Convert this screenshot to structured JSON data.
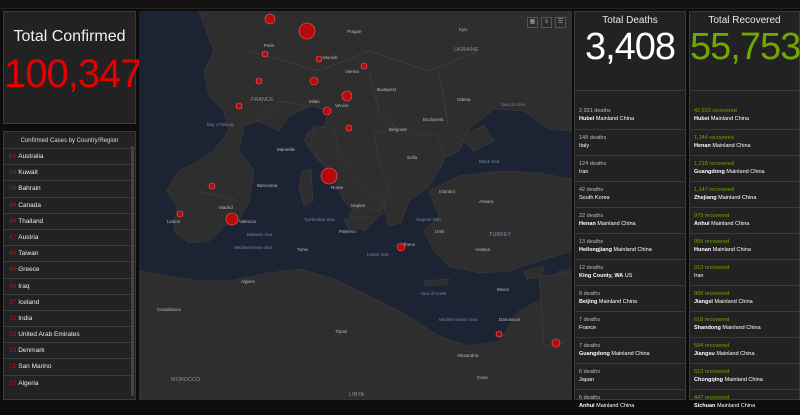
{
  "confirmed": {
    "title": "Total Confirmed",
    "value": "100,347"
  },
  "country_list": {
    "header": "Confirmed Cases by Country/Region",
    "items": [
      {
        "num": "61",
        "name": "Australia"
      },
      {
        "num": "58",
        "name": "Kuwait"
      },
      {
        "num": "55",
        "name": "Bahrain"
      },
      {
        "num": "48",
        "name": "Canada"
      },
      {
        "num": "48",
        "name": "Thailand"
      },
      {
        "num": "47",
        "name": "Austria"
      },
      {
        "num": "45",
        "name": "Taiwan"
      },
      {
        "num": "45",
        "name": "Greece"
      },
      {
        "num": "40",
        "name": "Iraq"
      },
      {
        "num": "37",
        "name": "Iceland"
      },
      {
        "num": "31",
        "name": "India"
      },
      {
        "num": "29",
        "name": "United Arab Emirates"
      },
      {
        "num": "23",
        "name": "Denmark"
      },
      {
        "num": "21",
        "name": "San Marino"
      },
      {
        "num": "17",
        "name": "Algeria"
      }
    ]
  },
  "deaths": {
    "title": "Total Deaths",
    "value": "3,408",
    "items": [
      {
        "count": "2,931 deaths",
        "region": "Hubei",
        "country": "Mainland China"
      },
      {
        "count": "148 deaths",
        "region": "",
        "country": "Italy"
      },
      {
        "count": "124 deaths",
        "region": "",
        "country": "Iran"
      },
      {
        "count": "42 deaths",
        "region": "",
        "country": "South Korea"
      },
      {
        "count": "22 deaths",
        "region": "Henan",
        "country": "Mainland China"
      },
      {
        "count": "13 deaths",
        "region": "Heilongjiang",
        "country": "Mainland China"
      },
      {
        "count": "12 deaths",
        "region": "King County, WA",
        "country": "US"
      },
      {
        "count": "8 deaths",
        "region": "Beijing",
        "country": "Mainland China"
      },
      {
        "count": "7 deaths",
        "region": "",
        "country": "France"
      },
      {
        "count": "7 deaths",
        "region": "Guangdong",
        "country": "Mainland China"
      },
      {
        "count": "6 deaths",
        "region": "",
        "country": "Japan"
      },
      {
        "count": "6 deaths",
        "region": "Anhui",
        "country": "Mainland China"
      }
    ]
  },
  "recovered": {
    "title": "Total Recovered",
    "value": "55,753",
    "items": [
      {
        "count": "42,633 recovered",
        "region": "Hubei",
        "country": "Mainland China"
      },
      {
        "count": "1,244 recovered",
        "region": "Henan",
        "country": "Mainland China"
      },
      {
        "count": "1,218 recovered",
        "region": "Guangdong",
        "country": "Mainland China"
      },
      {
        "count": "1,147 recovered",
        "region": "Zhejiang",
        "country": "Mainland China"
      },
      {
        "count": "979 recovered",
        "region": "Anhui",
        "country": "Mainland China"
      },
      {
        "count": "955 recovered",
        "region": "Hunan",
        "country": "Mainland China"
      },
      {
        "count": "913 recovered",
        "region": "",
        "country": "Iran"
      },
      {
        "count": "909 recovered",
        "region": "Jiangxi",
        "country": "Mainland China"
      },
      {
        "count": "618 recovered",
        "region": "Shandong",
        "country": "Mainland China"
      },
      {
        "count": "594 recovered",
        "region": "Jiangsu",
        "country": "Mainland China"
      },
      {
        "count": "513 recovered",
        "region": "Chongqing",
        "country": "Mainland China"
      },
      {
        "count": "447 recovered",
        "region": "Sichuan",
        "country": "Mainland China"
      }
    ]
  },
  "map": {
    "labels": {
      "ukraine": "UKRAINE",
      "france": "FRANCE",
      "turkey": "TURKEY",
      "morocco": "MOROCCO",
      "libya": "LIBYA",
      "bay": "Bay of Biscay",
      "balearic": "Balearic Sea",
      "tyrrhenian": "Tyrrhenian Sea",
      "ionian": "Ionian Sea",
      "aegean": "Aegean Sea",
      "med1": "Mediterranean Sea",
      "med2": "Mediterranean Sea",
      "black": "Black Sea",
      "azov": "Sea of Azov",
      "crete": "Sea of Crete",
      "rome": "Rome",
      "madrid": "Madrid",
      "paris": "Paris",
      "athens": "Athens",
      "alexandria": "Alexandria",
      "tunis": "Tunis",
      "algiers": "Algiers",
      "damascus": "Damascus",
      "istanbul": "Istanbul",
      "casablanca": "Casablanca",
      "lisbon": "Lisbon",
      "marseille": "Marseille",
      "milan": "Milan",
      "tripoli": "Tripoli",
      "belgrade": "Belgrade",
      "budapest": "Budapest",
      "vienna": "Vienna",
      "prague": "Prague",
      "bucharest": "Bucharest",
      "sofia": "Sofia",
      "ankara": "Ankara",
      "beirut": "Beirut",
      "cairo": "Cairo",
      "valencia": "Valencia",
      "barcelona": "Barcelona",
      "munich": "Munich",
      "venice": "Venice",
      "naples": "Naples",
      "palermo": "Palermo",
      "izmir": "Izmir",
      "antalya": "Antalya",
      "kyiv": "Kyiv",
      "odesa": "Odesa"
    }
  },
  "colors": {
    "confirmed": "#e60000",
    "recovered": "#70a800",
    "deaths": "#ffffff",
    "bubble": "#e60000"
  }
}
